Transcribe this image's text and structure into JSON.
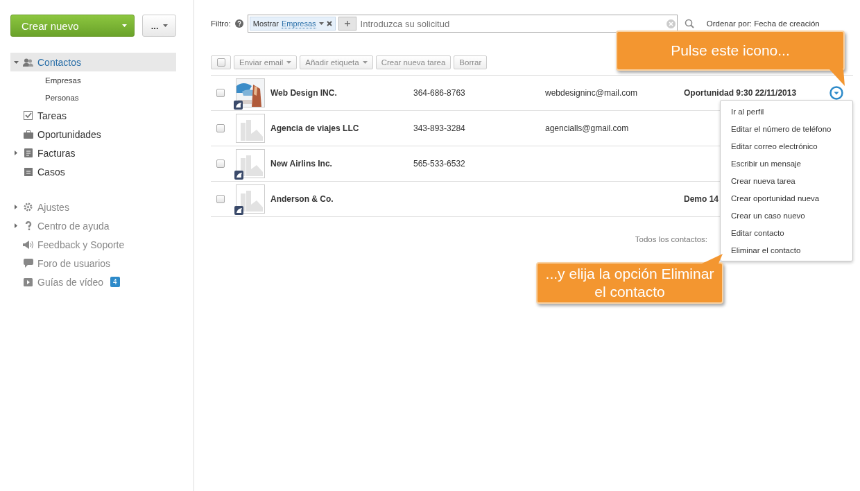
{
  "sidebar": {
    "create_button": "Crear nuevo",
    "more_button": "...",
    "nav": [
      {
        "label": "Contactos",
        "expanded": true,
        "selected": true,
        "children": [
          {
            "label": "Empresas"
          },
          {
            "label": "Personas"
          }
        ]
      },
      {
        "label": "Tareas",
        "selected": false
      },
      {
        "label": "Oportunidades",
        "selected": false
      },
      {
        "label": "Facturas",
        "expanded": false,
        "selected": false
      },
      {
        "label": "Casos",
        "selected": false
      }
    ],
    "secondary": [
      {
        "label": "Ajustes",
        "expanded": false
      },
      {
        "label": "Centro de ayuda",
        "expanded": false
      },
      {
        "label": "Feedback y Soporte"
      },
      {
        "label": "Foro de usuarios"
      },
      {
        "label": "Guías de vídeo",
        "badge": "4"
      }
    ]
  },
  "filter": {
    "label": "Filtro:",
    "tag_prefix": "Mostrar",
    "tag_value": "Empresas",
    "placeholder": "Introduzca su solicitud",
    "sort": "Ordenar por: Fecha de creación"
  },
  "toolbar": {
    "select_all_checked": false,
    "buttons": [
      {
        "label": "Enviar email",
        "dropdown": true
      },
      {
        "label": "Añadir etiqueta",
        "dropdown": true
      },
      {
        "label": "Crear nueva tarea",
        "dropdown": false
      },
      {
        "label": "Borrar",
        "dropdown": false
      }
    ]
  },
  "rows": [
    {
      "name": "Web Design INC.",
      "phone": "364-686-8763",
      "email": "webdesigninc@mail.com",
      "event": "Oportunidad 9:30 22/11/2013",
      "has_photo": true,
      "badge": true,
      "checked": false
    },
    {
      "name": "Agencia de viajes LLC",
      "phone": "343-893-3284",
      "email": "agencialls@gmail.com",
      "event": "",
      "has_photo": false,
      "badge": false,
      "checked": false
    },
    {
      "name": "New Airlins Inc.",
      "phone": "565-533-6532",
      "email": "",
      "event": "",
      "has_photo": false,
      "badge": true,
      "checked": false
    },
    {
      "name": "Anderson & Co.",
      "phone": "",
      "email": "",
      "event": "Demo 14",
      "has_photo": false,
      "badge": true,
      "checked": false
    }
  ],
  "footer": "Todos los contactos:",
  "menu": {
    "open": true,
    "items": [
      "Ir al perfil",
      "Editar el número de teléfono",
      "Editar correo electrónico",
      "Escribir un mensaje",
      "Crear nueva tarea",
      "Crear oportunidad nueva",
      "Crear un caso nuevo",
      "Editar contacto",
      "Eliminar el contacto"
    ]
  },
  "callouts": [
    {
      "text": "Pulse este icono..."
    },
    {
      "text": "...y elija la opción Eliminar el contacto"
    }
  ]
}
